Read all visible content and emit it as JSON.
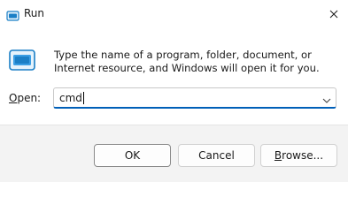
{
  "window": {
    "title": "Run"
  },
  "icons": {
    "app": "run-icon",
    "close": "close-icon",
    "content": "run-icon",
    "dropdown": "chevron-down-icon"
  },
  "description": "Type the name of a program, folder, document, or Internet resource, and Windows will open it for you.",
  "open_field": {
    "label_accel": "O",
    "label_rest": "pen:",
    "value": "cmd"
  },
  "buttons": {
    "ok": "OK",
    "cancel": "Cancel",
    "browse_accel": "B",
    "browse_rest": "rowse..."
  },
  "colors": {
    "accent": "#005fb8",
    "footer_bg": "#f3f3f3"
  }
}
